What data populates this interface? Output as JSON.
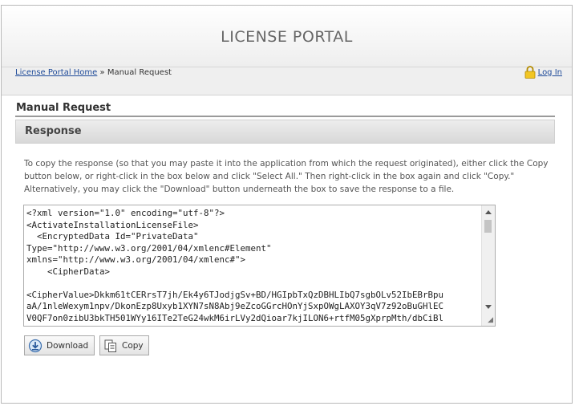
{
  "header": {
    "title": "LICENSE PORTAL"
  },
  "breadcrumb": {
    "home_link": "License Portal Home",
    "separator": "»",
    "current": "Manual Request"
  },
  "auth": {
    "login_label": "Log In",
    "icon": "lock-icon"
  },
  "section": {
    "title": "Manual Request",
    "subtitle": "Response"
  },
  "instructions": "To copy the response (so that you may paste it into the application from which the request originated), either click the Copy button below, or right-click in the box below and click \"Select All.\" Then right-click in the box again and click \"Copy.\" Alternatively, you may click the \"Download\" button underneath the box to save the response to a file.",
  "response_text": "<?xml version=\"1.0\" encoding=\"utf-8\"?>\n<ActivateInstallationLicenseFile>\n  <EncryptedData Id=\"PrivateData\"\nType=\"http://www.w3.org/2001/04/xmlenc#Element\"\nxmlns=\"http://www.w3.org/2001/04/xmlenc#\">\n    <CipherData>\n\n<CipherValue>Dkkm61tCERrsT7jh/Ek4y6TJodjgSv+BD/HGIpbTxQzDBHLIbQ7sgbOLv52IbEBrBpu\naA/1nleWexym1npv/DkonEzp8Uxyb1XYN7sN8Abj9eZcoGGrcHOnYjSxpOWgLAXOY3qV7z92oBuGHlEC\nV0QF7on0zibU3bkTH501WYy16ITe2TeG24wkM6irLVy2dQioar7kjILON6+rtfM05gXprpMth/dbCiBl",
  "buttons": {
    "download_label": "Download",
    "copy_label": "Copy"
  },
  "icons": {
    "download": "download-icon",
    "copy": "copy-icon"
  }
}
